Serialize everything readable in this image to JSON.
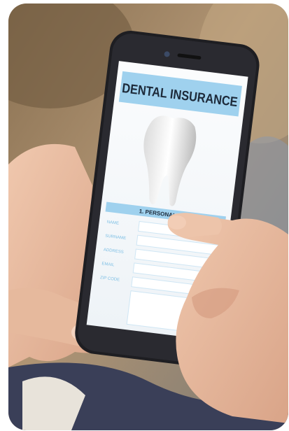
{
  "image": {
    "subject": "hands-holding-phone",
    "screen": {
      "title": "DENTAL INSURANCE",
      "section_header": "1. PERSONAL DATA",
      "field_labels": [
        "NAME",
        "SURNAME",
        "ADDRESS",
        "EMAIL",
        "ZIP CODE"
      ],
      "icon": "tooth-icon"
    },
    "colors": {
      "accent": "#9fd1ee",
      "label": "#7dbfe4",
      "phone_body": "#1e1e22",
      "skin": "#e4b79c",
      "background_warm": "#a98a66",
      "sweater": "#3a3f58"
    }
  }
}
